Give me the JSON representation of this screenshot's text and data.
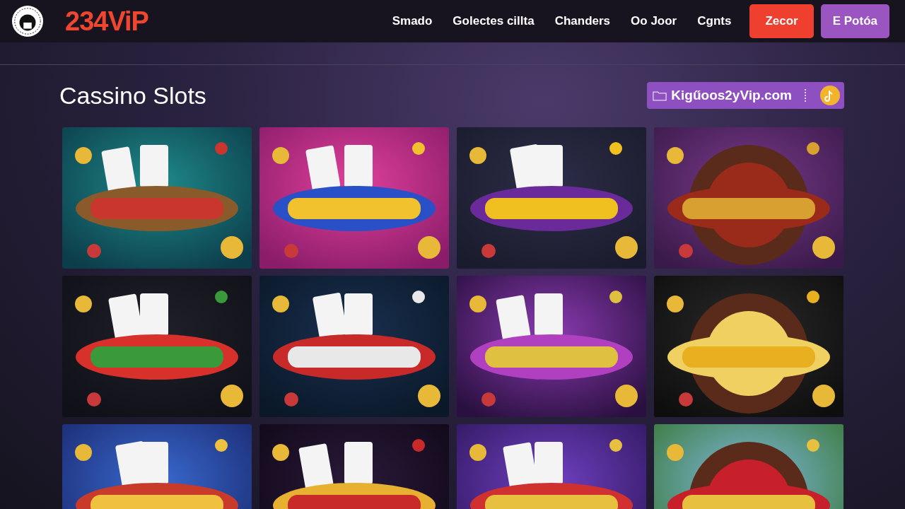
{
  "header": {
    "brand": "234ViP",
    "nav": [
      {
        "label": "Smado"
      },
      {
        "label": "Golectes cillta"
      },
      {
        "label": "Chanders"
      },
      {
        "label": "Oo Joor"
      },
      {
        "label": "Cgnts"
      }
    ],
    "buttons": [
      {
        "label": "Zecor",
        "kind": "primary"
      },
      {
        "label": "E Potóa",
        "kind": "secondary"
      }
    ]
  },
  "section": {
    "title": "Cassino Slots",
    "site_badge": "Kigűoos2yVip.com"
  }
}
